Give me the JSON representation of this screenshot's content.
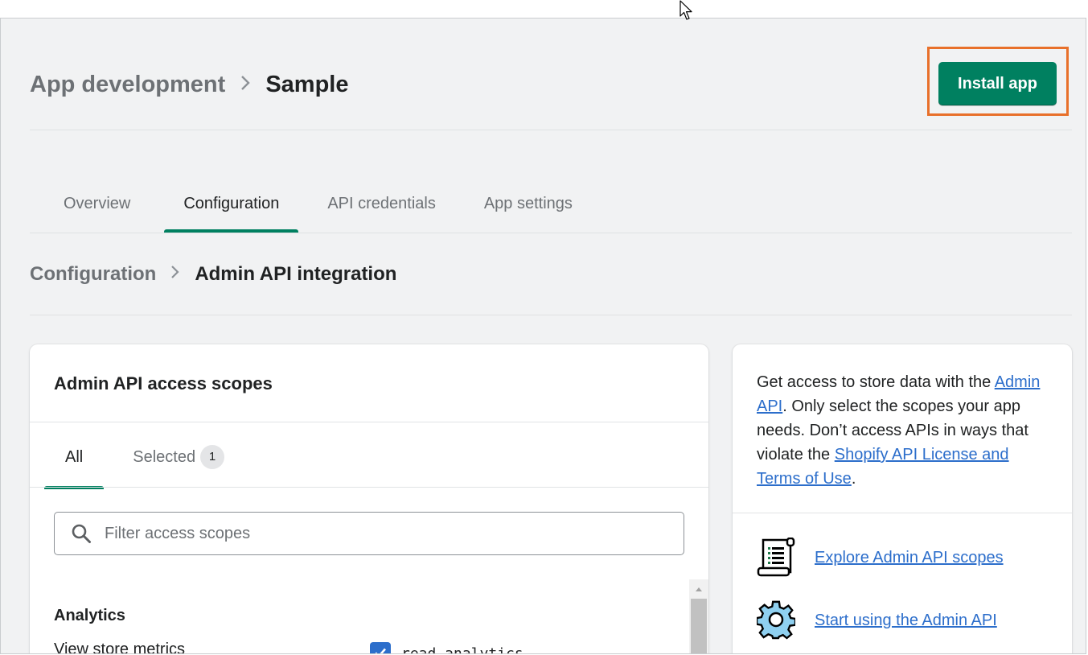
{
  "breadcrumb": {
    "parent": "App development",
    "current": "Sample"
  },
  "install_button": {
    "label": "Install app",
    "highlight_color": "#e8702a"
  },
  "tabs": [
    {
      "label": "Overview"
    },
    {
      "label": "Configuration",
      "active": true
    },
    {
      "label": "API credentials"
    },
    {
      "label": "App settings"
    }
  ],
  "sub_breadcrumb": {
    "parent": "Configuration",
    "current": "Admin API integration"
  },
  "scopes_card": {
    "title": "Admin API access scopes",
    "tabs": {
      "all": "All",
      "selected": "Selected",
      "selected_count": "1"
    },
    "search_placeholder": "Filter access scopes",
    "section": "Analytics",
    "scope_label": "View store metrics",
    "scope_code": "read_analytics",
    "scope_checked": true
  },
  "info_card": {
    "text_1": "Get access to store data with the ",
    "link_1": "Admin API",
    "text_2": ". Only select the scopes your app needs. Don’t access APIs in ways that violate the ",
    "link_2": "Shopify API License and Terms of Use",
    "text_3": ".",
    "links": [
      {
        "label": "Explore Admin API scopes",
        "icon": "scroll-icon"
      },
      {
        "label": "Start using the Admin API",
        "icon": "gear-icon"
      }
    ]
  },
  "colors": {
    "primary": "#008060",
    "link": "#2c6ecb",
    "checkbox": "#2c6ecb"
  }
}
